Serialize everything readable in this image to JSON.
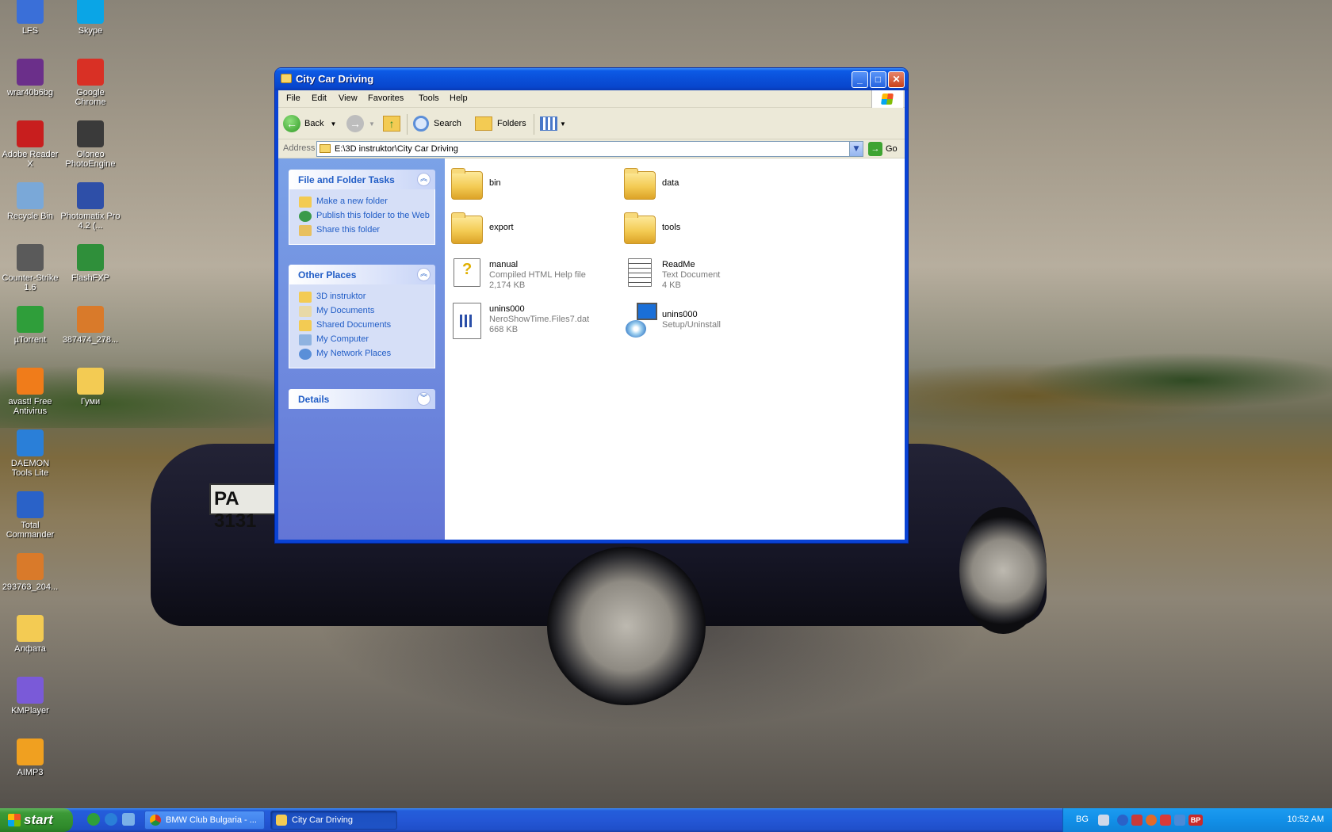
{
  "desktop": {
    "icons": [
      {
        "label": "LFS",
        "icon": "lfs-icon",
        "color": "#3a6fd8"
      },
      {
        "label": "Skype",
        "icon": "skype-icon",
        "color": "#0aa5e6"
      },
      {
        "label": "wrar40b6bg",
        "icon": "winrar-icon",
        "color": "#6b2f8a"
      },
      {
        "label": "Google Chrome",
        "icon": "chrome-icon",
        "color": "#d93025"
      },
      {
        "label": "Adobe Reader X",
        "icon": "adobe-reader-icon",
        "color": "#c81e1e"
      },
      {
        "label": "Oloneo PhotoEngine",
        "icon": "oloneo-icon",
        "color": "#3a3a3a"
      },
      {
        "label": "Recycle Bin",
        "icon": "recycle-bin-icon",
        "color": "#7aa8d8"
      },
      {
        "label": "Photomatix Pro 4.2 (...",
        "icon": "photomatix-icon",
        "color": "#2e4fa8"
      },
      {
        "label": "Counter-Strike 1.6",
        "icon": "counter-strike-icon",
        "color": "#5a5a5a"
      },
      {
        "label": "FlashFXP",
        "icon": "flashfxp-icon",
        "color": "#2f8f3a"
      },
      {
        "label": "µTorrent",
        "icon": "utorrent-icon",
        "color": "#2f9e3a"
      },
      {
        "label": "387474_278...",
        "icon": "image-file-icon",
        "color": "#d97a2a"
      },
      {
        "label": "avast! Free Antivirus",
        "icon": "avast-icon",
        "color": "#f07c1a"
      },
      {
        "label": "Гуми",
        "icon": "folder-icon",
        "color": "#f3cb53"
      },
      {
        "label": "DAEMON Tools Lite",
        "icon": "daemon-tools-icon",
        "color": "#2a7fd8"
      },
      {
        "label": "Total Commander",
        "icon": "total-commander-icon",
        "color": "#2a62c8"
      },
      {
        "label": "293763_204...",
        "icon": "image-file-icon",
        "color": "#d97a2a"
      },
      {
        "label": "Алфата",
        "icon": "folder-icon",
        "color": "#f3cb53"
      },
      {
        "label": "KMPlayer",
        "icon": "kmplayer-icon",
        "color": "#7a5ad8"
      },
      {
        "label": "AIMP3",
        "icon": "aimp-icon",
        "color": "#f0a020"
      }
    ]
  },
  "window": {
    "title": "City Car Driving",
    "menu": [
      "File",
      "Edit",
      "View",
      "Favorites",
      "Tools",
      "Help"
    ],
    "toolbar": {
      "back": "Back",
      "search": "Search",
      "folders": "Folders"
    },
    "address": {
      "label": "Address",
      "value": "E:\\3D instruktor\\City Car Driving",
      "go": "Go"
    },
    "tasks_panel": {
      "title": "File and Folder Tasks",
      "links": [
        "Make a new folder",
        "Publish this folder to the Web",
        "Share this folder"
      ]
    },
    "places_panel": {
      "title": "Other Places",
      "links": [
        "3D instruktor",
        "My Documents",
        "Shared Documents",
        "My Computer",
        "My Network Places"
      ]
    },
    "details_panel": {
      "title": "Details"
    },
    "files": [
      {
        "name": "bin",
        "type": "",
        "size": "",
        "kind": "folder"
      },
      {
        "name": "data",
        "type": "",
        "size": "",
        "kind": "folder"
      },
      {
        "name": "export",
        "type": "",
        "size": "",
        "kind": "folder"
      },
      {
        "name": "tools",
        "type": "",
        "size": "",
        "kind": "folder"
      },
      {
        "name": "manual",
        "type": "Compiled HTML Help file",
        "size": "2,174 KB",
        "kind": "chm"
      },
      {
        "name": "ReadMe",
        "type": "Text Document",
        "size": "4 KB",
        "kind": "txt"
      },
      {
        "name": "unins000",
        "type": "NeroShowTime.Files7.dat",
        "size": "668 KB",
        "kind": "dat"
      },
      {
        "name": "unins000",
        "type": "Setup/Uninstall",
        "size": "",
        "kind": "exe"
      }
    ]
  },
  "taskbar": {
    "start": "start",
    "tasks": [
      "BMW Club Bulgaria - ...",
      "City Car Driving"
    ],
    "language": "BG",
    "clock": "10:52 AM",
    "tray_label": "BP"
  },
  "background": {
    "plate_text": "PA 3131"
  }
}
